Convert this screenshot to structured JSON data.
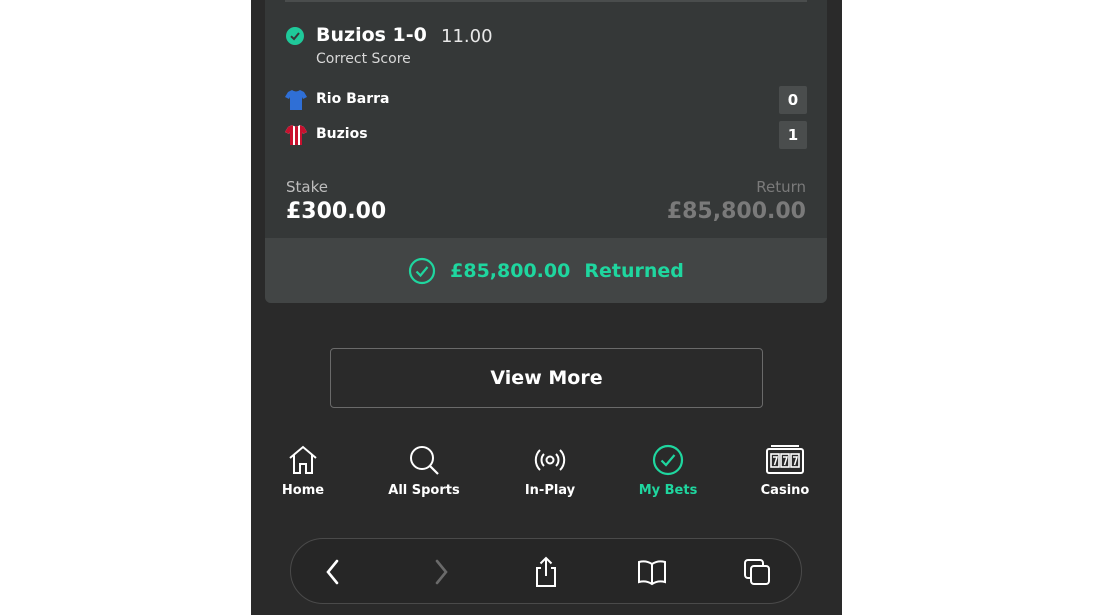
{
  "selection": {
    "title": "Buzios 1-0",
    "odds": "11.00",
    "market": "Correct Score",
    "status_icon": "check-circle-icon"
  },
  "teams": [
    {
      "name": "Rio Barra",
      "score": "0",
      "shirt_icon": "blue-shirt-icon"
    },
    {
      "name": "Buzios",
      "score": "1",
      "shirt_icon": "red-white-striped-shirt-icon"
    }
  ],
  "bet": {
    "stake_label": "Stake",
    "stake_value": "£300.00",
    "return_label": "Return",
    "return_value": "£85,800.00"
  },
  "returned": {
    "amount": "£85,800.00",
    "label": "Returned",
    "icon": "check-circle-outline-icon"
  },
  "view_more_label": "View More",
  "bottom_nav": [
    {
      "label": "Home",
      "icon": "home-icon",
      "active": false
    },
    {
      "label": "All Sports",
      "icon": "search-icon",
      "active": false
    },
    {
      "label": "In-Play",
      "icon": "broadcast-icon",
      "active": false
    },
    {
      "label": "My Bets",
      "icon": "check-circle-icon",
      "active": true
    },
    {
      "label": "Casino",
      "icon": "slot-machine-icon",
      "active": false
    }
  ],
  "browser_toolbar": [
    "back-icon",
    "forward-icon",
    "share-icon",
    "bookmarks-icon",
    "tabs-icon"
  ],
  "colors": {
    "accent": "#1fd69f",
    "background": "#2a2a2a",
    "card": "#353838",
    "muted": "#7a7a7a"
  }
}
